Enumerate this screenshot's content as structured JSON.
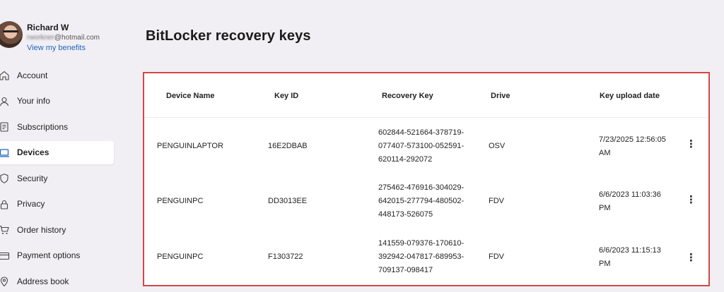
{
  "profile": {
    "name": "Richard W",
    "email_masked": "rworkner",
    "email_domain": "@hotmail.com",
    "benefits_link": "View my benefits"
  },
  "nav": {
    "items": [
      {
        "label": "Account",
        "icon": "home-icon"
      },
      {
        "label": "Your info",
        "icon": "person-icon"
      },
      {
        "label": "Subscriptions",
        "icon": "receipt-icon"
      },
      {
        "label": "Devices",
        "icon": "laptop-icon",
        "active": true
      },
      {
        "label": "Security",
        "icon": "shield-icon"
      },
      {
        "label": "Privacy",
        "icon": "lock-icon"
      },
      {
        "label": "Order history",
        "icon": "cart-icon"
      },
      {
        "label": "Payment options",
        "icon": "card-icon"
      },
      {
        "label": "Address book",
        "icon": "location-icon"
      }
    ]
  },
  "page": {
    "title": "BitLocker recovery keys"
  },
  "colors": {
    "accent": "#1e66c4",
    "highlight_border": "#d14848",
    "background": "#f1eff3"
  },
  "table": {
    "headers": [
      "Device Name",
      "Key ID",
      "Recovery Key",
      "Drive",
      "Key upload date"
    ],
    "rows": [
      {
        "device": "PENGUINLAPTOR",
        "key_id": "16E2DBAB",
        "recovery_key": [
          "602844-521664-378719-",
          "077407-573100-052591-",
          "620114-292072"
        ],
        "drive": "OSV",
        "date": [
          "7/23/2025 12:56:05",
          "AM"
        ]
      },
      {
        "device": "PENGUINPC",
        "key_id": "DD3013EE",
        "recovery_key": [
          "275462-476916-304029-",
          "642015-277794-480502-",
          "448173-526075"
        ],
        "drive": "FDV",
        "date": [
          "6/6/2023 11:03:36",
          "PM"
        ]
      },
      {
        "device": "PENGUINPC",
        "key_id": "F1303722",
        "recovery_key": [
          "141559-079376-170610-",
          "392942-047817-689953-",
          "709137-098417"
        ],
        "drive": "FDV",
        "date": [
          "6/6/2023 11:15:13",
          "PM"
        ]
      }
    ],
    "more_icon": "more-vertical-icon"
  }
}
